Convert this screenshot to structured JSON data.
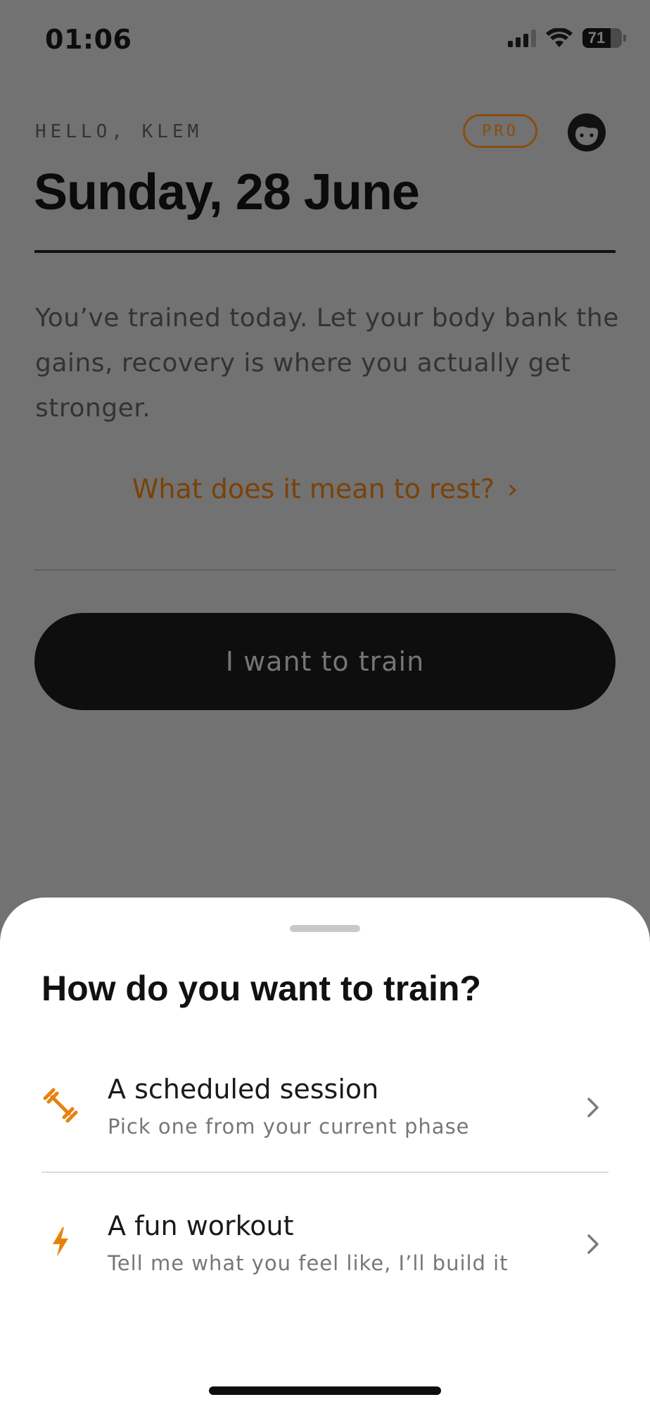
{
  "status_bar": {
    "time": "01:06",
    "battery": "71",
    "icons": [
      "signal-icon",
      "wifi-icon",
      "battery-icon"
    ]
  },
  "header": {
    "greeting": "HELLO, KLEM",
    "pro_badge": "PRO",
    "title": "Sunday, 28 June"
  },
  "main": {
    "rest_message": "You’ve trained today. Let your body bank the gains, recovery is where you actually get stronger.",
    "rest_link": "What does it mean to rest?",
    "train_button": "I want to train"
  },
  "sheet": {
    "title": "How do you want to train?",
    "options": [
      {
        "title": "A scheduled session",
        "subtitle": "Pick one from your current phase",
        "icon": "dumbbell-icon"
      },
      {
        "title": "A fun workout",
        "subtitle": "Tell me what you feel like, I’ll build it",
        "icon": "lightning-icon"
      }
    ]
  },
  "colors": {
    "accent": "#E8820E",
    "accent_dimmed": "#7A4208",
    "overlay": "#727272",
    "button": "#0E0E0E",
    "sheet": "#FFFFFF"
  }
}
